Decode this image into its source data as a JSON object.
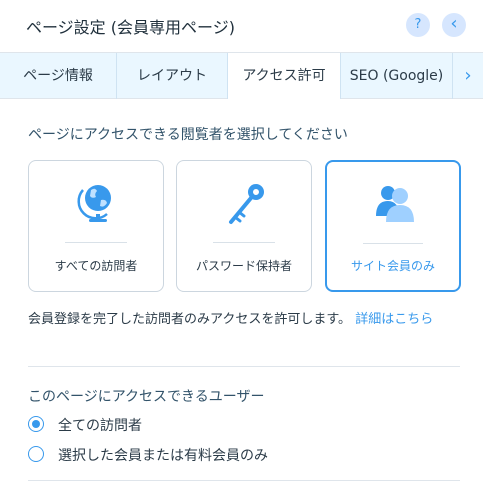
{
  "header": {
    "title": "ページ設定 (会員専用ページ)",
    "help_label": "?",
    "back_label": "‹"
  },
  "tabs": [
    {
      "label": "ページ情報"
    },
    {
      "label": "レイアウト"
    },
    {
      "label": "アクセス許可",
      "active": true
    },
    {
      "label": "SEO (Google)"
    },
    {
      "label": "›"
    }
  ],
  "permissions": {
    "heading": "ページにアクセスできる閲覧者を選択してください",
    "options": [
      {
        "label": "すべての訪問者",
        "icon": "globe-icon"
      },
      {
        "label": "パスワード保持者",
        "icon": "key-icon"
      },
      {
        "label": "サイト会員のみ",
        "icon": "members-icon",
        "selected": true
      }
    ],
    "info_text": "会員登録を完了した訪問者のみアクセスを許可します。",
    "info_link": "詳細はこちら"
  },
  "members_access": {
    "heading": "このページにアクセスできるユーザー",
    "options": [
      {
        "label": "全ての訪問者",
        "checked": true
      },
      {
        "label": "選択した会員または有料会員のみ",
        "checked": false
      }
    ]
  },
  "colors": {
    "accent": "#3899ec",
    "tab_bar": "#eaf7ff",
    "icon_button_bg": "#d6e6fe"
  }
}
